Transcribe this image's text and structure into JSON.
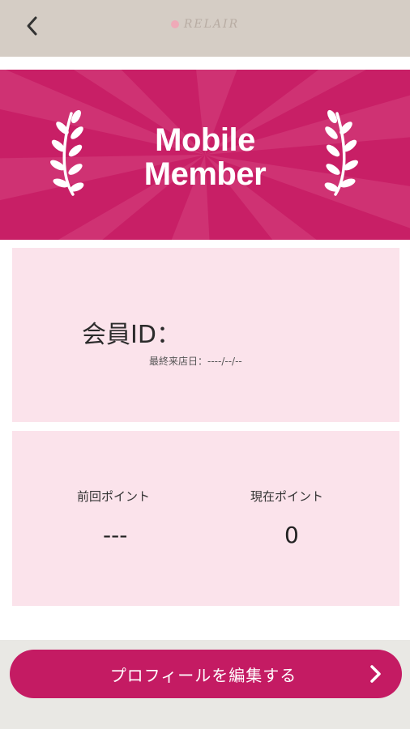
{
  "header": {
    "logo_text": "RELAIR",
    "back_icon": "chevron-left-icon"
  },
  "banner": {
    "title_line1": "Mobile",
    "title_line2": "Member",
    "color": "#c81f66"
  },
  "member": {
    "id_label": "会員ID：",
    "last_visit_label": "最終来店日：",
    "last_visit_value": "----/--/--"
  },
  "points": {
    "previous_label": "前回ポイント",
    "previous_value": "---",
    "current_label": "現在ポイント",
    "current_value": "0"
  },
  "actions": {
    "edit_profile_label": "プロフィールを編集する",
    "edit_profile_icon": "chevron-right-icon",
    "accent": "#c41b63"
  }
}
